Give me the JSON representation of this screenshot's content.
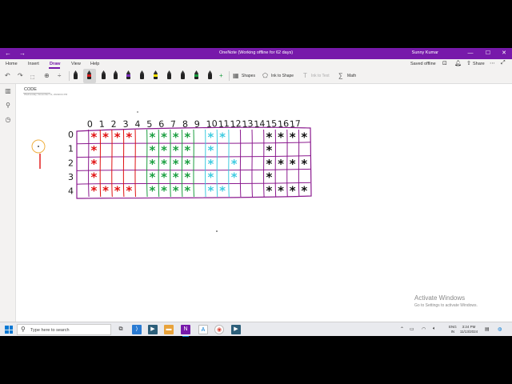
{
  "titlebar": {
    "title": "OneNote (Working offline for 62 days)",
    "user": "Sunny Kumar",
    "back_icon": "back-arrow-icon",
    "forward_icon": "forward-arrow-icon",
    "accent_color": "#7719aa"
  },
  "menu": {
    "items": [
      "Home",
      "Insert",
      "Draw",
      "View",
      "Help"
    ],
    "active": "Draw",
    "saved_status": "Saved offline",
    "share_label": "Share"
  },
  "ribbon": {
    "shapes_label": "Shapes",
    "ink_to_shape_label": "Ink to Shape",
    "ink_to_text_label": "Ink to Text",
    "math_label": "Math",
    "pen_colors": [
      "#222222",
      "#d81b1b",
      "#222222",
      "#222222",
      "#7b2fbe",
      "#222222",
      "#f2e200",
      "#222222",
      "#222222",
      "#1a9e3f",
      "#222222",
      "#1a9e3f",
      "#17b8c6",
      "#7b2fbe"
    ]
  },
  "page": {
    "title": "CODE",
    "date": "Wednesday, November 13, 2024",
    "time": "3:04 PM"
  },
  "drawing": {
    "column_labels": [
      "0",
      "1",
      "2",
      "3",
      "4",
      "5",
      "6",
      "7",
      "8",
      "9",
      "10",
      "11",
      "12",
      "13",
      "14",
      "15",
      "16",
      "17"
    ],
    "row_labels": [
      "0",
      "1",
      "2",
      "3",
      "4"
    ],
    "star_glyph": "*",
    "colors": {
      "grid": "#8b1a8f",
      "red": "#e01010",
      "green": "#1a9e3f",
      "cyan": "#3ecbe0",
      "black": "#111111",
      "stroke": "#1a1a1a"
    },
    "stars": [
      {
        "col": 1,
        "row": 0,
        "color": "red"
      },
      {
        "col": 2,
        "row": 0,
        "color": "red"
      },
      {
        "col": 3,
        "row": 0,
        "color": "red"
      },
      {
        "col": 4,
        "row": 0,
        "color": "red"
      },
      {
        "col": 1,
        "row": 1,
        "color": "red"
      },
      {
        "col": 1,
        "row": 2,
        "color": "red"
      },
      {
        "col": 1,
        "row": 3,
        "color": "red"
      },
      {
        "col": 1,
        "row": 4,
        "color": "red"
      },
      {
        "col": 2,
        "row": 4,
        "color": "red"
      },
      {
        "col": 3,
        "row": 4,
        "color": "red"
      },
      {
        "col": 4,
        "row": 4,
        "color": "red"
      },
      {
        "col": 6,
        "row": 0,
        "color": "green"
      },
      {
        "col": 7,
        "row": 0,
        "color": "green"
      },
      {
        "col": 8,
        "row": 0,
        "color": "green"
      },
      {
        "col": 9,
        "row": 0,
        "color": "green"
      },
      {
        "col": 6,
        "row": 1,
        "color": "green"
      },
      {
        "col": 7,
        "row": 1,
        "color": "green"
      },
      {
        "col": 8,
        "row": 1,
        "color": "green"
      },
      {
        "col": 9,
        "row": 1,
        "color": "green"
      },
      {
        "col": 6,
        "row": 2,
        "color": "green"
      },
      {
        "col": 7,
        "row": 2,
        "color": "green"
      },
      {
        "col": 8,
        "row": 2,
        "color": "green"
      },
      {
        "col": 9,
        "row": 2,
        "color": "green"
      },
      {
        "col": 6,
        "row": 3,
        "color": "green"
      },
      {
        "col": 7,
        "row": 3,
        "color": "green"
      },
      {
        "col": 8,
        "row": 3,
        "color": "green"
      },
      {
        "col": 9,
        "row": 3,
        "color": "green"
      },
      {
        "col": 6,
        "row": 4,
        "color": "green"
      },
      {
        "col": 7,
        "row": 4,
        "color": "green"
      },
      {
        "col": 8,
        "row": 4,
        "color": "green"
      },
      {
        "col": 9,
        "row": 4,
        "color": "green"
      },
      {
        "col": 11,
        "row": 0,
        "color": "cyan"
      },
      {
        "col": 12,
        "row": 0,
        "color": "cyan"
      },
      {
        "col": 11,
        "row": 1,
        "color": "cyan"
      },
      {
        "col": 11,
        "row": 2,
        "color": "cyan"
      },
      {
        "col": 13,
        "row": 2,
        "color": "cyan"
      },
      {
        "col": 11,
        "row": 3,
        "color": "cyan"
      },
      {
        "col": 13,
        "row": 3,
        "color": "cyan"
      },
      {
        "col": 11,
        "row": 4,
        "color": "cyan"
      },
      {
        "col": 12,
        "row": 4,
        "color": "cyan"
      },
      {
        "col": 16,
        "row": 0,
        "color": "black"
      },
      {
        "col": 17,
        "row": 0,
        "color": "black"
      },
      {
        "col": 18,
        "row": 0,
        "color": "black"
      },
      {
        "col": 19,
        "row": 0,
        "color": "black"
      },
      {
        "col": 16,
        "row": 1,
        "color": "black"
      },
      {
        "col": 16,
        "row": 2,
        "color": "black"
      },
      {
        "col": 17,
        "row": 2,
        "color": "black"
      },
      {
        "col": 18,
        "row": 2,
        "color": "black"
      },
      {
        "col": 19,
        "row": 2,
        "color": "black"
      },
      {
        "col": 16,
        "row": 3,
        "color": "black"
      },
      {
        "col": 16,
        "row": 4,
        "color": "black"
      },
      {
        "col": 17,
        "row": 4,
        "color": "black"
      },
      {
        "col": 18,
        "row": 4,
        "color": "black"
      },
      {
        "col": 19,
        "row": 4,
        "color": "black"
      }
    ]
  },
  "watermark": {
    "line1": "Activate Windows",
    "line2": "Go to Settings to activate Windows."
  },
  "taskbar": {
    "search_placeholder": "Type here to search",
    "language": "ENG",
    "region": "IN",
    "time": "3:24 PM",
    "date": "11/13/2024"
  }
}
